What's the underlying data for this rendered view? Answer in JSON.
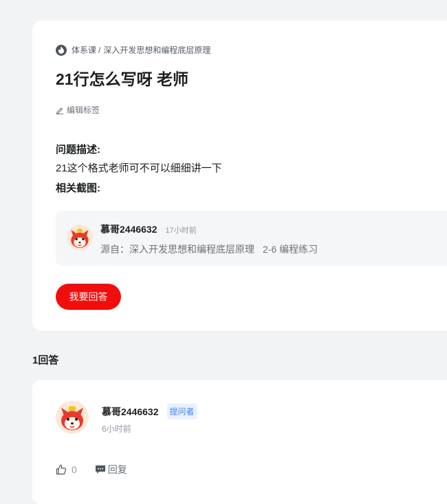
{
  "question": {
    "breadcrumb": {
      "course_type": "体系课",
      "separator": "/",
      "course_name": "深入开发思想和编程底层原理"
    },
    "title": "21行怎么写呀 老师",
    "edit_tag_label": "编辑标签",
    "description_heading": "问题描述:",
    "description_text": "21这个格式老师可不可以细细讲一下",
    "screenshot_heading": "相关截图:",
    "source": {
      "username": "慕哥2446632",
      "time": "17小时前",
      "from_label": "源自：深入开发思想和编程底层原理",
      "chapter": "2-6 编程练习"
    },
    "answer_button_label": "我要回答"
  },
  "answers_count_label": "1回答",
  "answer": {
    "username": "慕哥2446632",
    "badge": "提问者",
    "time": "6小时前",
    "like_count": "0",
    "reply_label": "回复"
  },
  "colors": {
    "accent": "#f20d0d",
    "badge_text": "#3c7ef6",
    "badge_bg": "#e9f1ff",
    "page_bg": "#f2f3f5"
  }
}
